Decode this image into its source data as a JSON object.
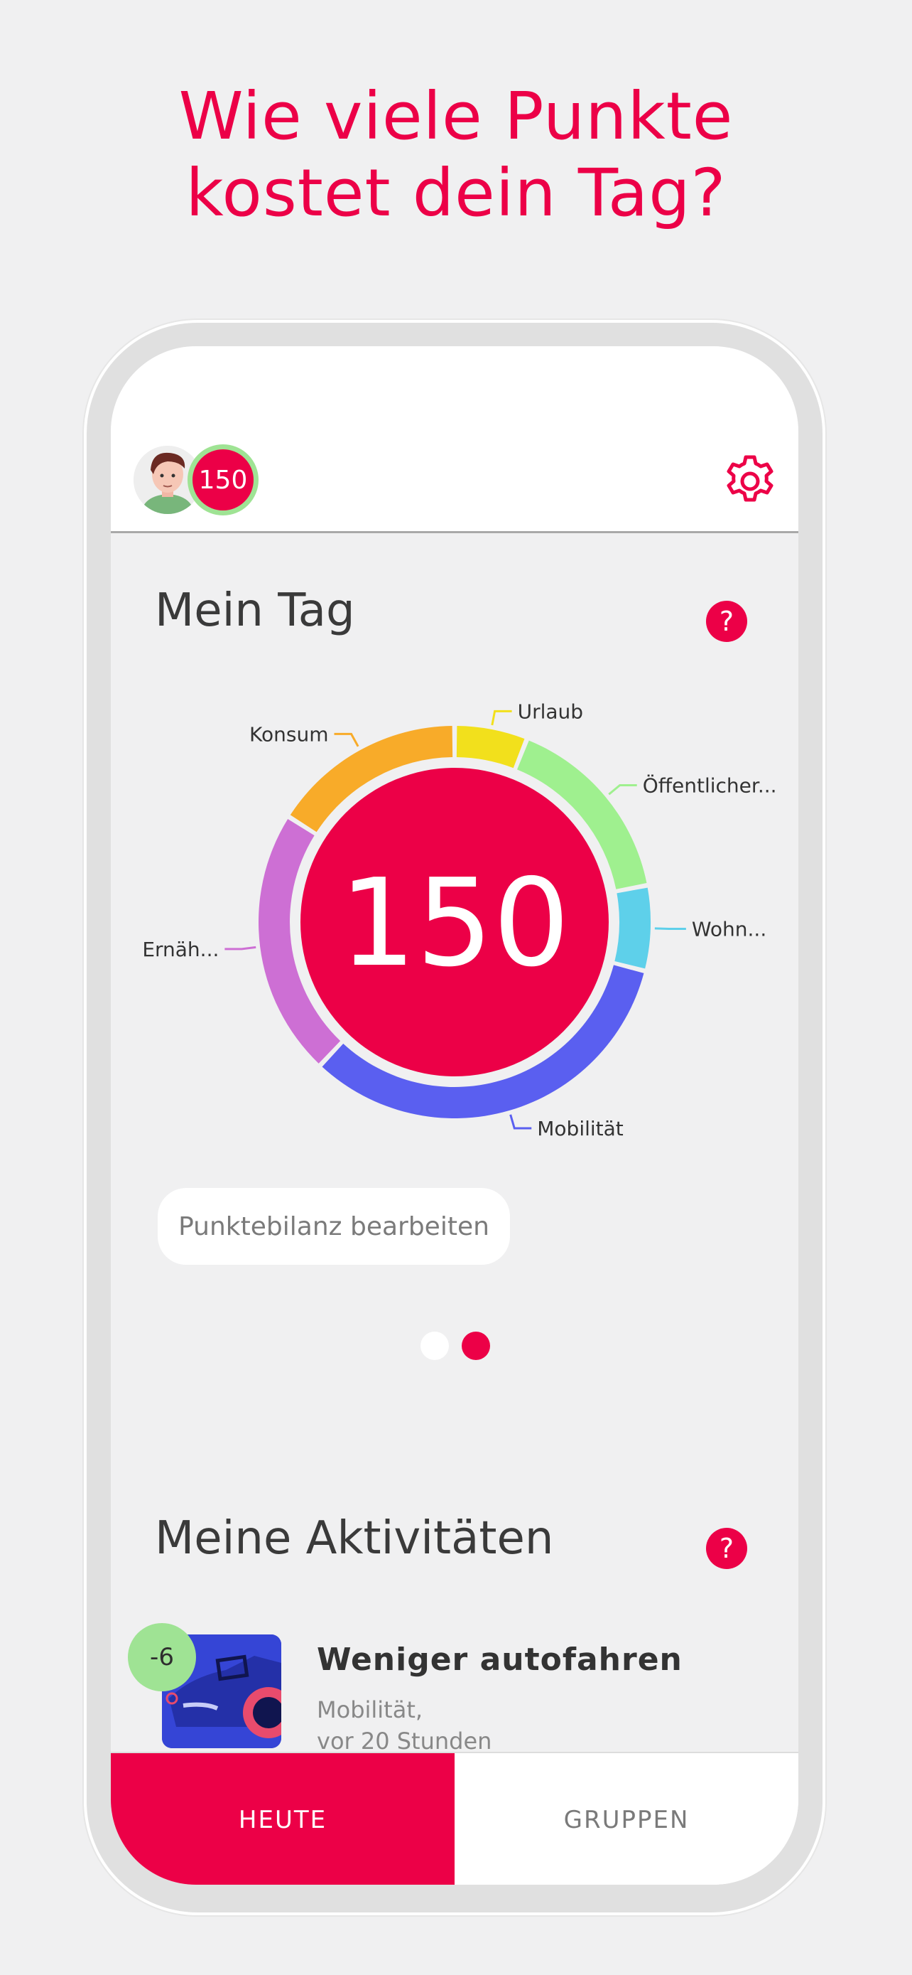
{
  "headline": [
    "Wie viele Punkte",
    "kostet dein Tag?"
  ],
  "header": {
    "score": "150",
    "settings_icon": "gear-icon"
  },
  "mein_tag": {
    "title": "Mein Tag",
    "help": "?",
    "edit_button": "Punktebilanz bearbeiten",
    "pager": {
      "pages": 2,
      "active": 2
    }
  },
  "chart_data": {
    "type": "pie",
    "center_value": "150",
    "categories": [
      "Urlaub",
      "Öffentlicher...",
      "Wohn...",
      "Mobilität",
      "Ernäh...",
      "Konsum"
    ],
    "colors": [
      "#f2e01c",
      "#9ff08f",
      "#5ed0ea",
      "#5a5ff0",
      "#cd6fd4",
      "#f8ab29"
    ],
    "values": [
      6,
      16,
      7,
      33,
      22,
      16
    ]
  },
  "activities": {
    "title": "Meine Aktivitäten",
    "help": "?",
    "items": [
      {
        "delta": "-6",
        "title": "Weniger autofahren",
        "category": "Mobilität,",
        "time": "vor 20 Stunden"
      }
    ]
  },
  "tabs": [
    {
      "label": "HEUTE",
      "active": true
    },
    {
      "label": "GRUPPEN",
      "active": false
    }
  ],
  "colors": {
    "accent": "#ec0047",
    "positive": "#9fe394"
  }
}
